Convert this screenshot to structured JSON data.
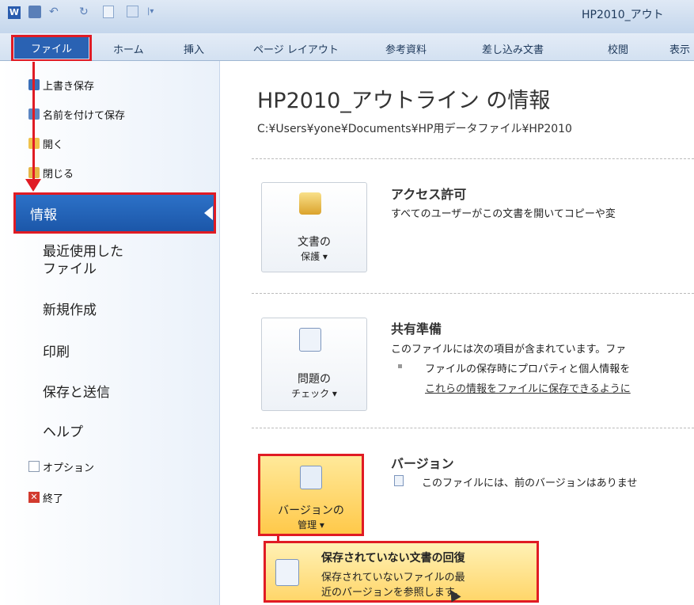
{
  "window": {
    "title": "HP2010_アウト"
  },
  "ribbon": {
    "file_tab": "ファイル",
    "tabs": [
      "ホーム",
      "挿入",
      "ページ レイアウト",
      "参考資料",
      "差し込み文書",
      "校閲",
      "表示"
    ]
  },
  "backstage": {
    "commands": [
      {
        "label": "上書き保存",
        "icon": "save-icon"
      },
      {
        "label": "名前を付けて保存",
        "icon": "save-as-icon"
      },
      {
        "label": "開く",
        "icon": "open-folder-icon"
      },
      {
        "label": "閉じる",
        "icon": "close-folder-icon"
      }
    ],
    "nav": [
      "情報",
      "最近使用した\nファイル",
      "新規作成",
      "印刷",
      "保存と送信",
      "ヘルプ"
    ],
    "nav_selected": "情報",
    "bottom": [
      {
        "label": "オプション",
        "icon": "options-icon"
      },
      {
        "label": "終了",
        "icon": "exit-icon"
      }
    ]
  },
  "info": {
    "title": "HP2010_アウトライン の情報",
    "path": "C:¥Users¥yone¥Documents¥HP用データファイル¥HP2010",
    "sections": [
      {
        "button_line1": "文書の",
        "button_line2": "保護 ▾",
        "title": "アクセス許可",
        "text": "すべてのユーザーがこの文書を開いてコピーや変"
      },
      {
        "button_line1": "問題の",
        "button_line2": "チェック ▾",
        "title": "共有準備",
        "text": "このファイルには次の項目が含まれています。ファ",
        "bullet": "ファイルの保存時にプロパティと個人情報を",
        "link": "これらの情報をファイルに保存できるように"
      },
      {
        "button_line1": "バージョンの",
        "button_line2": "管理 ▾",
        "title": "バージョン",
        "text": "このファイルには、前のバージョンはありませ"
      }
    ],
    "recover": {
      "title": "保存されていない文書の回復",
      "line1": "保存されていないファイルの最",
      "line2": "近のバージョンを参照します。"
    }
  }
}
